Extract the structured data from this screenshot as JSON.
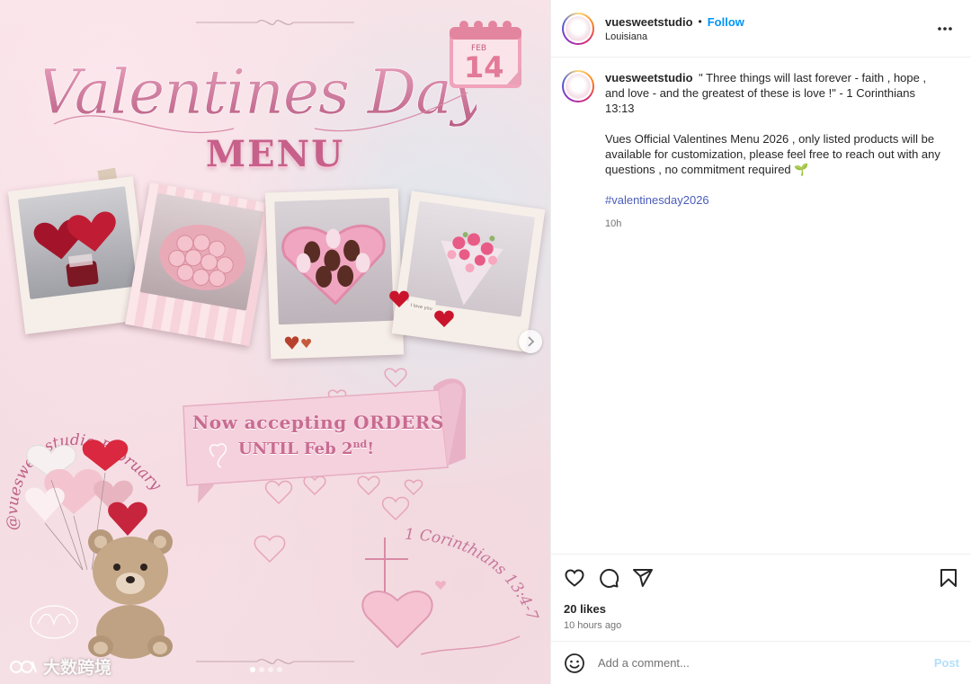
{
  "media": {
    "title_line": "Valentines Day",
    "menu_word": "MENU",
    "calendar": {
      "month": "FEB",
      "day": "14"
    },
    "banner": {
      "line1": "Now accepting ORDERS",
      "line2": "UNTIL Feb 2",
      "line2_sup": "nd",
      "line2_end": "!"
    },
    "handle_arc": "@vuesweetstudio February 2026",
    "verse_arc": "1 Corinthians 13:4-7",
    "tag_note": "I love you",
    "watermark": "大数跨境"
  },
  "header": {
    "username": "vuesweetstudio",
    "bullet": "•",
    "follow_label": "Follow",
    "location": "Louisiana",
    "more_icon": "more-horizontal-icon"
  },
  "caption": {
    "username": "vuesweetstudio",
    "quote": "\" Three things will last forever - faith , hope , and love - and the greatest of these is love !\" - 1 Corinthians 13:13",
    "body": "Vues Official Valentines Menu 2026 , only listed products will be available for customization, please feel free to reach out with any questions , no commitment required 🌱",
    "hashtag": "#valentinesday2026",
    "time": "10h"
  },
  "actions": {
    "icons": [
      "heart-icon",
      "comment-icon",
      "share-icon",
      "bookmark-icon"
    ],
    "likes": "20 likes",
    "ago": "10 hours ago"
  },
  "comment": {
    "placeholder": "Add a comment...",
    "post_label": "Post"
  },
  "colors": {
    "follow_blue": "#0095f6",
    "post_disabled": "#b2dffc",
    "accent_pink": "#c7608a"
  }
}
